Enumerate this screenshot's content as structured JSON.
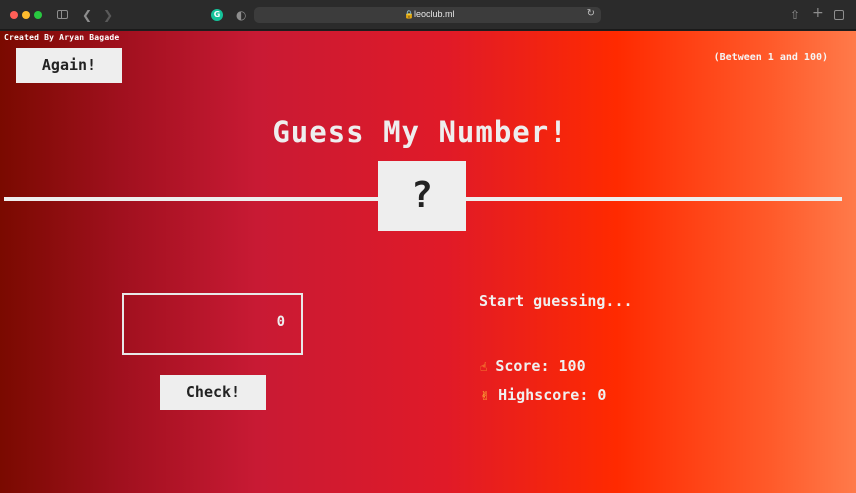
{
  "browser": {
    "url": "leoclub.ml",
    "icons": [
      "sidebar-icon",
      "back-icon",
      "forward-icon",
      "grammarly-icon",
      "shield-icon",
      "lock-icon",
      "reload-icon",
      "share-icon",
      "new-tab-icon",
      "tabs-overview-icon"
    ]
  },
  "page": {
    "credit": "Created By Aryan Bagade",
    "again_label": "Again!",
    "range_hint": "(Between 1 and 100)",
    "title": "Guess My Number!",
    "secret": "?",
    "guess_value": "0",
    "check_label": "Check!",
    "message": "Start guessing...",
    "score_label": "Score:",
    "score_value": "100",
    "highscore_label": "Highscore:",
    "highscore_value": "0"
  },
  "colors": {
    "gradient_left": "#7a0a00",
    "gradient_mid": "#e01a28",
    "gradient_right": "#ff7a4a",
    "panel": "#eeeeee"
  }
}
